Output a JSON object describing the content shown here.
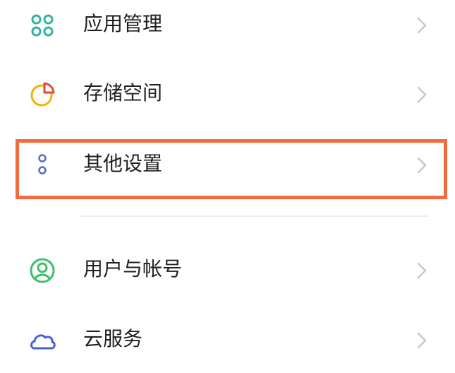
{
  "colors": {
    "highlight_border": "#f26b3a",
    "text": "#1f1f1f",
    "chevron": "#c8c8c8",
    "divider": "#ececec"
  },
  "settings": {
    "items": [
      {
        "label": "应用管理",
        "icon": "app-grid-icon",
        "icon_color": "#2fb3a3"
      },
      {
        "label": "存储空间",
        "icon": "storage-pie-icon",
        "icon_color": "#f2b400"
      },
      {
        "label": "其他设置",
        "icon": "more-dots-icon",
        "icon_color": "#5b6dbf",
        "highlighted": true
      },
      {
        "label": "用户与帐号",
        "icon": "user-account-icon",
        "icon_color": "#3fbf6a"
      },
      {
        "label": "云服务",
        "icon": "cloud-icon",
        "icon_color": "#4460d6"
      }
    ]
  }
}
